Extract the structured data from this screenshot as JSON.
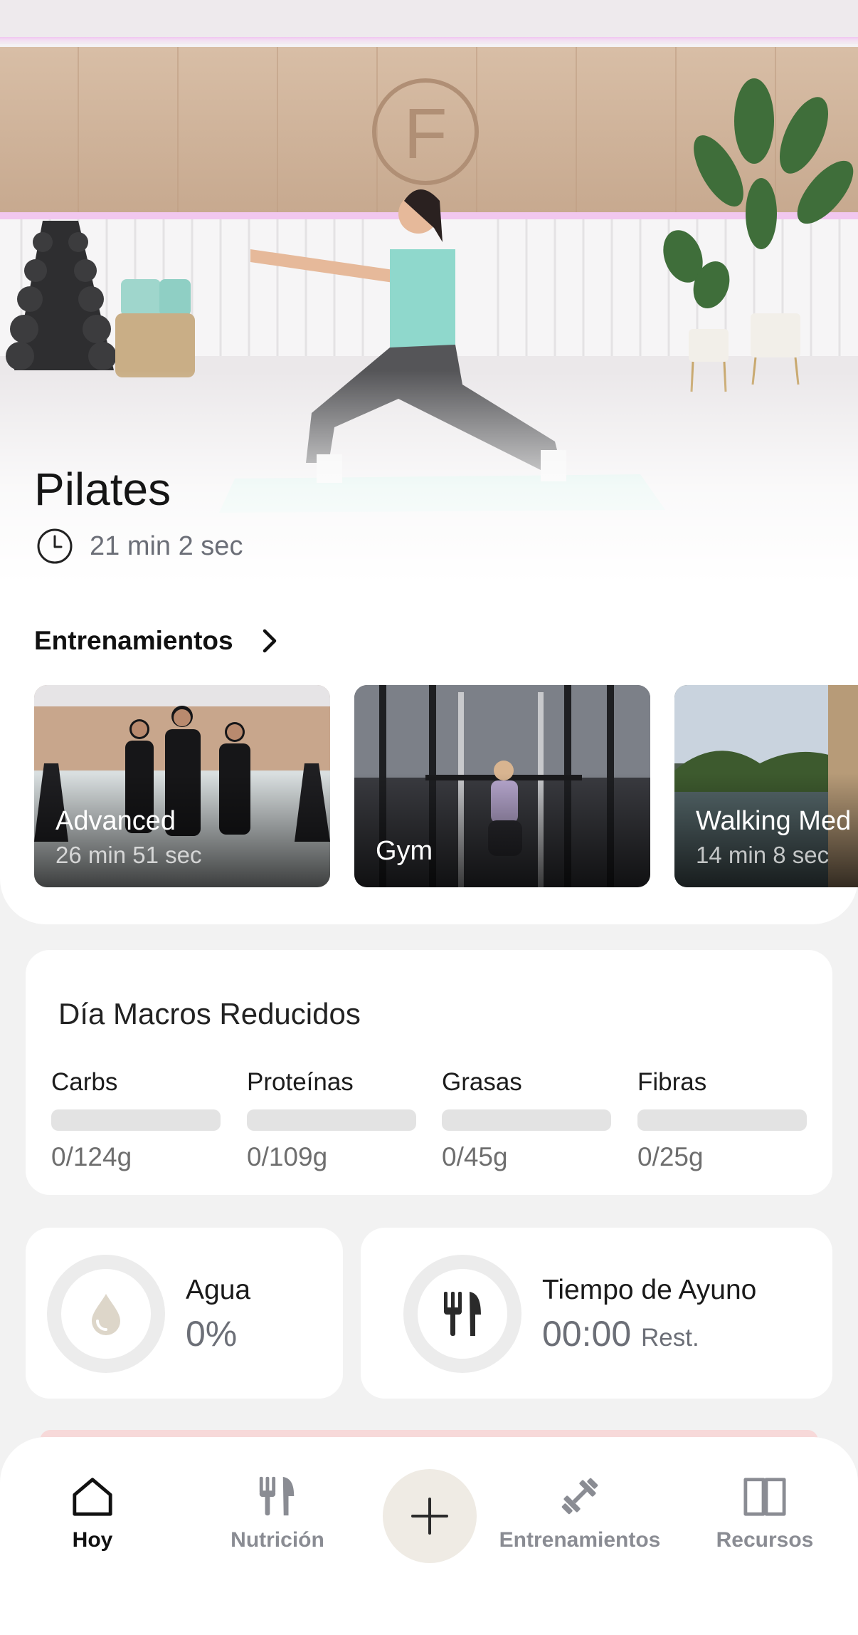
{
  "hero": {
    "title": "Pilates",
    "duration": "21 min 2 sec",
    "icon": "clock-icon"
  },
  "workouts_section": {
    "title": "Entrenamientos",
    "cards": [
      {
        "name": "Advanced",
        "duration": "26 min 51 sec"
      },
      {
        "name": "Gym",
        "duration": ""
      },
      {
        "name": "Walking Med",
        "duration": "14 min 8 sec"
      }
    ]
  },
  "macros": {
    "title": "Día Macros Reducidos",
    "items": [
      {
        "label": "Carbs",
        "value": "0/124g",
        "progress": 0
      },
      {
        "label": "Proteínas",
        "value": "0/109g",
        "progress": 0
      },
      {
        "label": "Grasas",
        "value": "0/45g",
        "progress": 0
      },
      {
        "label": "Fibras",
        "value": "0/25g",
        "progress": 0
      }
    ]
  },
  "water": {
    "title": "Agua",
    "value": "0%",
    "icon": "water-drop-icon"
  },
  "fasting": {
    "title": "Tiempo de Ayuno",
    "value": "00:00",
    "suffix": "Rest.",
    "icon": "fork-knife-icon"
  },
  "nav": {
    "items": [
      {
        "label": "Hoy",
        "icon": "home-icon",
        "active": true
      },
      {
        "label": "Nutrición",
        "icon": "fork-knife-icon",
        "active": false
      },
      {
        "label": "Entrenamientos",
        "icon": "dumbbell-icon",
        "active": false
      },
      {
        "label": "Recursos",
        "icon": "book-icon",
        "active": false
      }
    ],
    "add_icon": "plus-icon"
  },
  "colors": {
    "background": "#f2f2f2",
    "card": "#ffffff",
    "muted_text": "#6e6e6e",
    "accent_beige": "#efebe4",
    "bar_track": "#e3e3e3"
  }
}
